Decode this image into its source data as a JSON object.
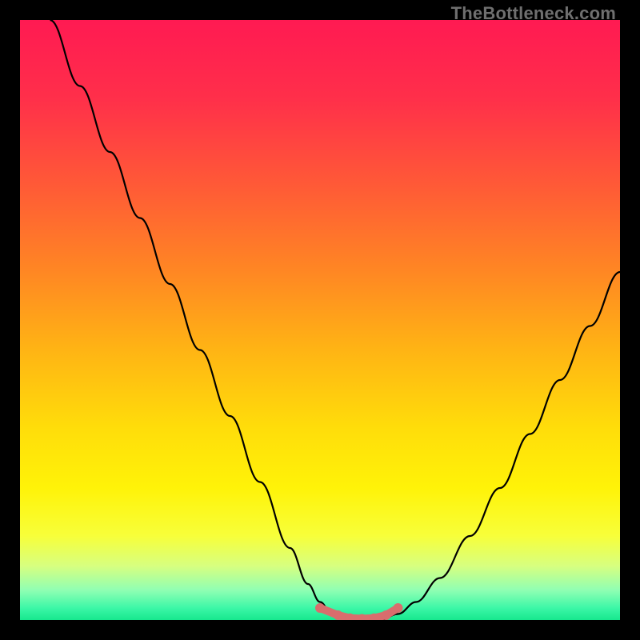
{
  "watermark": "TheBottleneck.com",
  "colors": {
    "bg": "#000000",
    "curve_stroke": "#000000",
    "marker_fill": "#d96d6d",
    "gradient_stops": [
      {
        "offset": 0.0,
        "color": "#ff1a52"
      },
      {
        "offset": 0.13,
        "color": "#ff2f4a"
      },
      {
        "offset": 0.28,
        "color": "#ff5b36"
      },
      {
        "offset": 0.42,
        "color": "#ff8723"
      },
      {
        "offset": 0.55,
        "color": "#ffb414"
      },
      {
        "offset": 0.68,
        "color": "#ffdd0a"
      },
      {
        "offset": 0.78,
        "color": "#fff308"
      },
      {
        "offset": 0.86,
        "color": "#f7ff3a"
      },
      {
        "offset": 0.91,
        "color": "#d7ff80"
      },
      {
        "offset": 0.95,
        "color": "#90ffb3"
      },
      {
        "offset": 0.98,
        "color": "#3cf7a7"
      },
      {
        "offset": 1.0,
        "color": "#17e88e"
      }
    ]
  },
  "chart_data": {
    "type": "line",
    "title": "",
    "xlabel": "",
    "ylabel": "",
    "xlim": [
      0,
      100
    ],
    "ylim": [
      0,
      100
    ],
    "grid": false,
    "legend": false,
    "series": [
      {
        "name": "bottleneck-curve",
        "x": [
          5,
          10,
          15,
          20,
          25,
          30,
          35,
          40,
          45,
          48,
          50,
          52,
          55,
          58,
          60,
          63,
          66,
          70,
          75,
          80,
          85,
          90,
          95,
          100
        ],
        "y": [
          100,
          89,
          78,
          67,
          56,
          45,
          34,
          23,
          12,
          6,
          3,
          1,
          0,
          0,
          0,
          1,
          3,
          7,
          14,
          22,
          31,
          40,
          49,
          58
        ]
      }
    ],
    "markers": {
      "name": "optimal-range",
      "x": [
        50,
        53,
        55,
        57,
        59,
        61,
        63
      ],
      "y": [
        2.0,
        0.8,
        0.3,
        0.2,
        0.3,
        0.8,
        2.0
      ]
    }
  }
}
